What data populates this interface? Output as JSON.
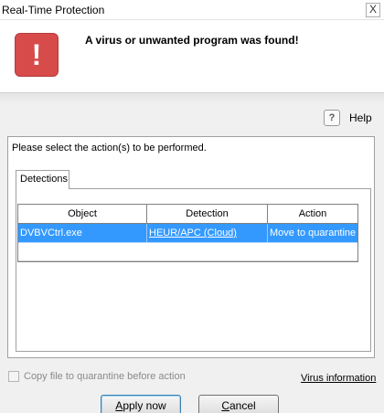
{
  "window": {
    "title": "Real-Time Protection",
    "close_glyph": "X"
  },
  "banner": {
    "icon": "alert-icon",
    "icon_glyph": "!",
    "headline": "A virus or unwanted program was found!",
    "accent": "#d74b4b"
  },
  "help": {
    "icon_glyph": "?",
    "label": "Help"
  },
  "panel": {
    "instruction": "Please select the action(s) to be performed."
  },
  "tabs": [
    {
      "label": "Detections",
      "selected": true
    }
  ],
  "table": {
    "columns": [
      "Object",
      "Detection",
      "Action"
    ],
    "rows": [
      {
        "object": "DVBVCtrl.exe",
        "detection": "HEUR/APC (Cloud)",
        "action": "Move to quarantine",
        "selected": true
      }
    ],
    "selection_color": "#3399ff"
  },
  "options": {
    "copy_label": "Copy file to quarantine before action",
    "copy_checked": false,
    "copy_enabled": false
  },
  "links": {
    "virus_info": "Virus information"
  },
  "buttons": {
    "apply": {
      "accel": "A",
      "rest": "pply now"
    },
    "cancel": {
      "accel": "C",
      "rest": "ancel"
    }
  }
}
